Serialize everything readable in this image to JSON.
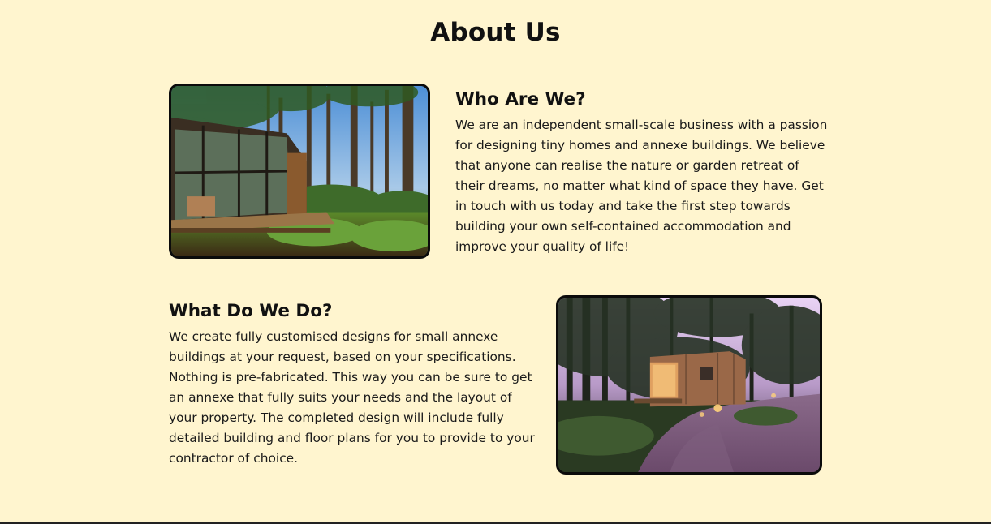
{
  "page": {
    "title": "About Us"
  },
  "sections": [
    {
      "heading": "Who Are We?",
      "body": "We are an independent small-scale business with a passion for designing tiny homes and annexe buildings. We believe that anyone can realise the nature or garden retreat of their dreams, no matter what kind of space they have. Get in touch with us today and take the first step towards building your own self-contained accommodation and improve your quality of life!",
      "image_alt": "Glass-walled cabin in a pine forest"
    },
    {
      "heading": "What Do We Do?",
      "body": "We create fully customised designs for small annexe buildings at your request, based on your specifications. Nothing is pre-fabricated. This way you can be sure to get an annexe that fully suits your needs and the layout of your property. The completed design will include fully detailed building and floor plans for you to provide to your contractor of choice.",
      "image_alt": "Wooden cabin at dusk with a gravel path in the woods"
    }
  ],
  "colors": {
    "background": "#fff5cf",
    "text": "#111111",
    "image_border": "#0b0b0b"
  }
}
